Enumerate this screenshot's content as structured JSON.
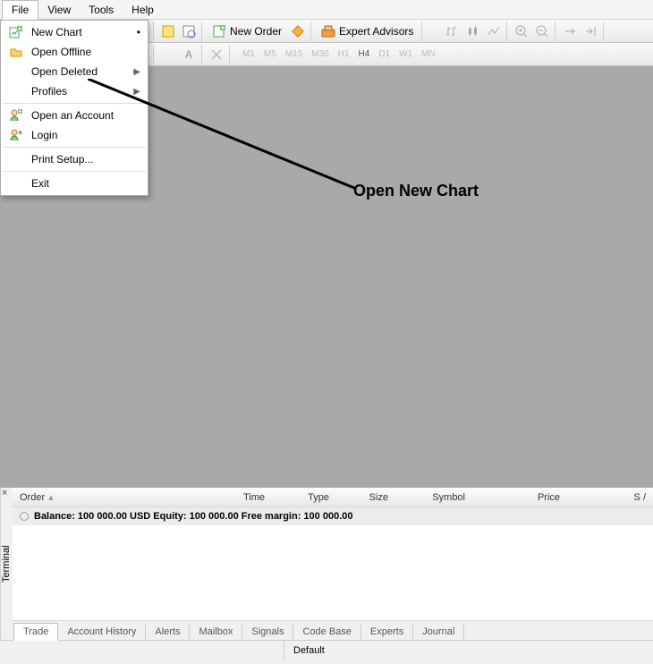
{
  "menubar": {
    "items": [
      "File",
      "View",
      "Tools",
      "Help"
    ],
    "active_index": 0
  },
  "file_menu": {
    "items": [
      {
        "icon": "chart-plus",
        "label": "New Chart"
      },
      {
        "icon": "folder",
        "label": "Open Offline"
      },
      {
        "icon": "",
        "label": "Open Deleted",
        "submenu": true
      },
      {
        "icon": "",
        "label": "Profiles",
        "submenu": true
      },
      {
        "sep": true
      },
      {
        "icon": "user-plus",
        "label": "Open an Account"
      },
      {
        "icon": "user-arrow",
        "label": "Login"
      },
      {
        "sep": true
      },
      {
        "icon": "",
        "label": "Print Setup..."
      },
      {
        "sep": true
      },
      {
        "icon": "",
        "label": "Exit"
      }
    ]
  },
  "toolbar1": {
    "new_order": "New Order",
    "expert_advisors": "Expert Advisors"
  },
  "timeframes": [
    "M1",
    "M5",
    "M15",
    "M30",
    "H1",
    "H4",
    "D1",
    "W1",
    "MN"
  ],
  "annotation": "Open New Chart",
  "terminal": {
    "vtitle": "Terminal",
    "headers": {
      "order": "Order",
      "time": "Time",
      "type": "Type",
      "size": "Size",
      "symbol": "Symbol",
      "price": "Price",
      "sl": "S /"
    },
    "balance_row": "Balance: 100 000.00 USD  Equity: 100 000.00  Free margin: 100 000.00",
    "tabs": [
      "Trade",
      "Account History",
      "Alerts",
      "Mailbox",
      "Signals",
      "Code Base",
      "Experts",
      "Journal"
    ],
    "active_tab_index": 0
  },
  "statusbar": {
    "help": "",
    "default": "Default"
  }
}
